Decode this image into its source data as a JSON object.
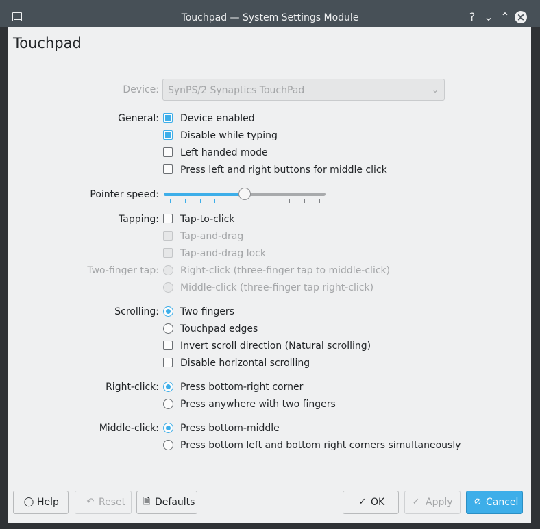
{
  "window": {
    "title": "Touchpad — System Settings Module",
    "controls": {
      "help": "?",
      "minimize": "⌄",
      "maximize": "⌃",
      "close": "×"
    }
  },
  "page_title": "Touchpad",
  "device": {
    "label": "Device:",
    "value": "SynPS/2 Synaptics TouchPad"
  },
  "general": {
    "label": "General:",
    "options": [
      {
        "label": "Device enabled",
        "checked": true
      },
      {
        "label": "Disable while typing",
        "checked": true
      },
      {
        "label": "Left handed mode",
        "checked": false
      },
      {
        "label": "Press left and right buttons for middle click",
        "checked": false
      }
    ]
  },
  "pointer_speed": {
    "label": "Pointer speed:",
    "value_fraction": 0.5,
    "ticks": 11
  },
  "tapping": {
    "label": "Tapping:",
    "options": [
      {
        "label": "Tap-to-click",
        "checked": false,
        "enabled": true
      },
      {
        "label": "Tap-and-drag",
        "checked": false,
        "enabled": false
      },
      {
        "label": "Tap-and-drag lock",
        "checked": false,
        "enabled": false
      }
    ]
  },
  "two_finger_tap": {
    "label": "Two-finger tap:",
    "options": [
      {
        "label": "Right-click (three-finger tap to middle-click)",
        "selected": false,
        "enabled": false
      },
      {
        "label": "Middle-click (three-finger tap right-click)",
        "selected": false,
        "enabled": false
      }
    ]
  },
  "scrolling": {
    "label": "Scrolling:",
    "radios": [
      {
        "label": "Two fingers",
        "selected": true
      },
      {
        "label": "Touchpad edges",
        "selected": false
      }
    ],
    "checks": [
      {
        "label": "Invert scroll direction (Natural scrolling)",
        "checked": false
      },
      {
        "label": "Disable horizontal scrolling",
        "checked": false
      }
    ]
  },
  "right_click": {
    "label": "Right-click:",
    "options": [
      {
        "label": "Press bottom-right corner",
        "selected": true
      },
      {
        "label": "Press anywhere with two fingers",
        "selected": false
      }
    ]
  },
  "middle_click": {
    "label": "Middle-click:",
    "options": [
      {
        "label": "Press bottom-middle",
        "selected": true
      },
      {
        "label": "Press bottom left and bottom right corners simultaneously",
        "selected": false
      }
    ]
  },
  "buttons": {
    "help": "Help",
    "reset": "Reset",
    "defaults": "Defaults",
    "ok": "OK",
    "apply": "Apply",
    "cancel": "Cancel"
  },
  "colors": {
    "accent": "#3daee9",
    "titlebar": "#475057",
    "window_bg": "#eff0f1"
  }
}
